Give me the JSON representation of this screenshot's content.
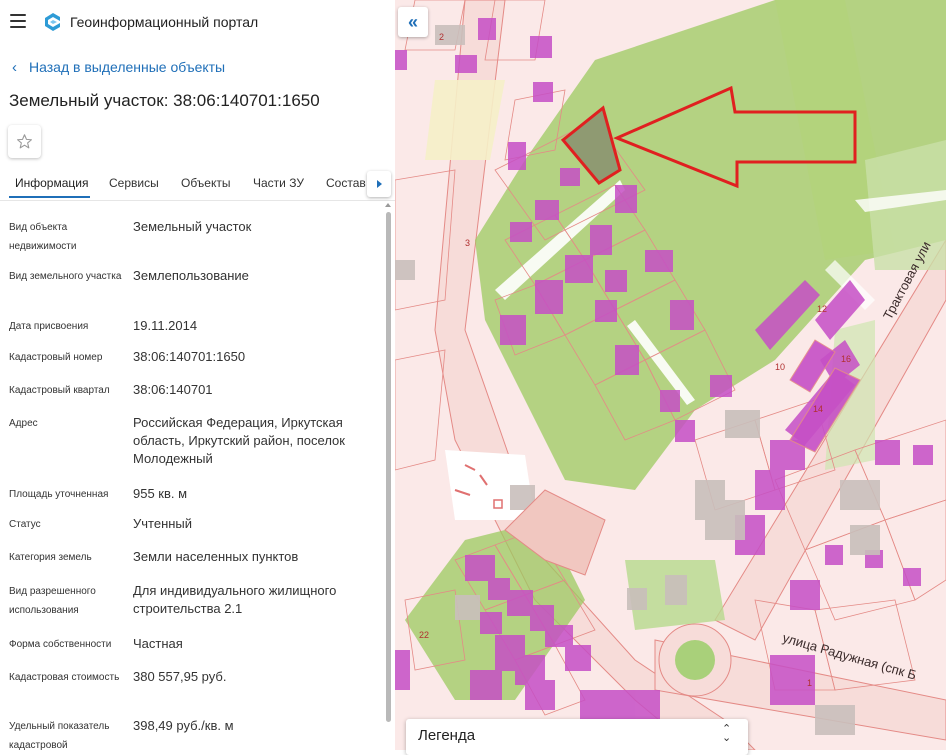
{
  "app": {
    "title": "Геоинформационный портал",
    "menu_icon": "menu-icon",
    "logo_icon": "portal-logo-icon"
  },
  "nav": {
    "back_label": "Назад в выделенные объекты"
  },
  "object": {
    "title": "Земельный участок: 38:06:140701:1650"
  },
  "tabs": [
    {
      "label": "Информация",
      "active": true
    },
    {
      "label": "Сервисы"
    },
    {
      "label": "Объекты"
    },
    {
      "label": "Части ЗУ"
    },
    {
      "label": "Состав"
    }
  ],
  "fields": [
    {
      "label": "Вид объекта недвижимости",
      "value": "Земельный участок"
    },
    {
      "label": "Вид земельного участка",
      "value": "Землепользование"
    },
    {
      "label": "Дата присвоения",
      "value": "19.11.2014"
    },
    {
      "label": "Кадастровый номер",
      "value": "38:06:140701:1650"
    },
    {
      "label": "Кадастровый квартал",
      "value": "38:06:140701"
    },
    {
      "label": "Адрес",
      "value": "Российская Федерация, Иркутская область, Иркутский район, поселок Молодежный"
    },
    {
      "label": "Площадь уточненная",
      "value": "955 кв. м"
    },
    {
      "label": "Статус",
      "value": "Учтенный"
    },
    {
      "label": "Категория земель",
      "value": "Земли населенных пунктов"
    },
    {
      "label": "Вид разрешенного использования",
      "value": "Для индивидуального жилищного строительства 2.1"
    },
    {
      "label": "Форма собственности",
      "value": "Частная"
    },
    {
      "label": "Кадастровая стоимость",
      "value": "380 557,95 руб."
    },
    {
      "label": "Удельный показатель кадастровой",
      "value": "398,49 руб./кв. м"
    }
  ],
  "map": {
    "collapse_symbol": "«",
    "legend_label": "Легенда",
    "legend_arrows": "⌃\n⌄",
    "streets": {
      "trakt": "Трактовая ули",
      "raduzhnaya": "улица Радужная  (спк Б"
    },
    "lot_numbers": [
      "2",
      "3",
      "10",
      "12",
      "14",
      "16",
      "22",
      "1"
    ],
    "colors": {
      "parcel_fill": "#fbe9e8",
      "parcel_line": "#e48a86",
      "building": "#c64fc6",
      "green": "#9cc960",
      "road": "#f7d9d6",
      "arrow": "#e02020",
      "highlight": "#8f9a72",
      "accent": "#1f6fb8"
    }
  }
}
